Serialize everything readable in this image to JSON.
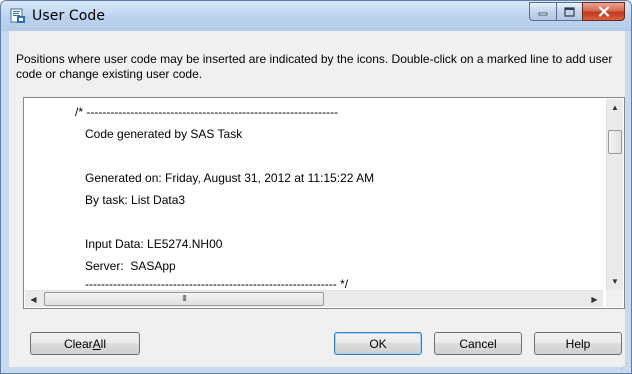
{
  "window": {
    "title": "User Code",
    "icon": "sas-document-icon"
  },
  "description": "Positions where user code may be inserted are indicated by the icons. Double-click on a marked line to add user code or change existing user code.",
  "code_lines": [
    "/* ---------------------------------------------------------------",
    "   Code generated by SAS Task",
    "",
    "   Generated on: Friday, August 31, 2012 at 11:15:22 AM",
    "   By task: List Data3",
    "",
    "   Input Data: LE5274.NH00",
    "   Server:  SASApp",
    "   --------------------------------------------------------------- */"
  ],
  "scroll": {
    "vertical_position": 0.1,
    "horizontal_thumb_glyph": "III"
  },
  "buttons": {
    "clear_all": {
      "prefix": "Clear ",
      "mnemonic": "A",
      "suffix": "ll"
    },
    "ok": "OK",
    "cancel": "Cancel",
    "help": "Help"
  }
}
